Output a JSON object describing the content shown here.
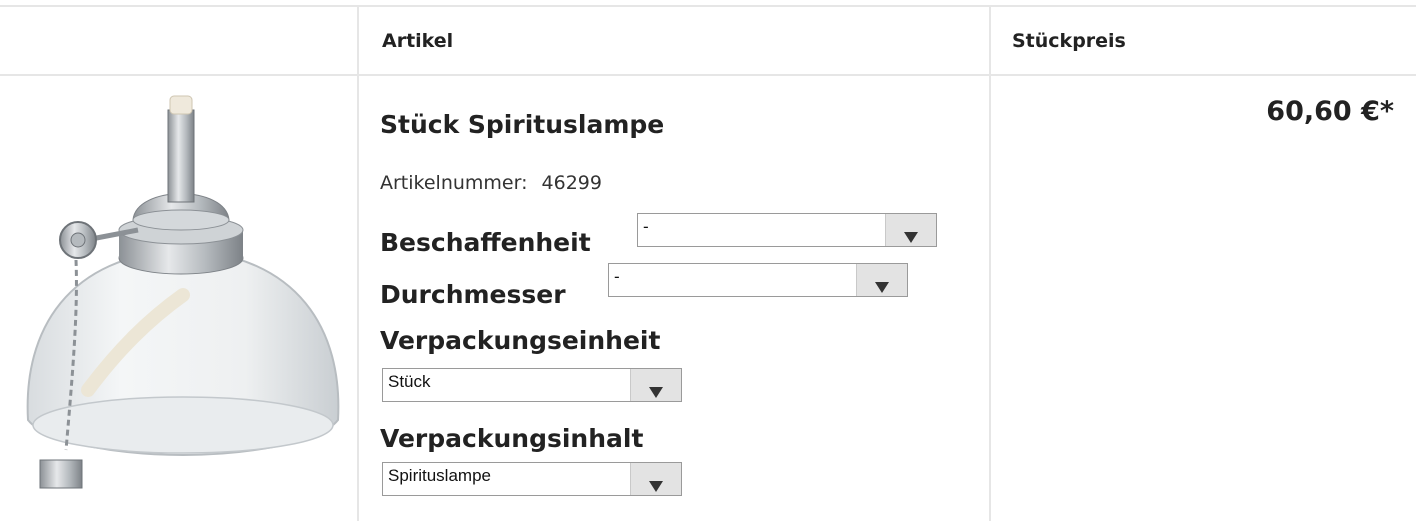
{
  "table": {
    "headers": {
      "col_article": "Artikel",
      "col_unit_price": "Stückpreis"
    }
  },
  "product": {
    "name": "Stück Spirituslampe",
    "article_number_label": "Artikelnummer:",
    "article_number": "46299",
    "price": "60,60 €*",
    "image": "alcohol-lamp-image",
    "options": {
      "beschaffenheit": {
        "label": "Beschaffenheit",
        "value": "-"
      },
      "durchmesser": {
        "label": "Durchmesser",
        "value": "-"
      },
      "verpackungseinheit": {
        "label": "Verpackungseinheit",
        "value": "Stück"
      },
      "verpackungsinhalt": {
        "label": "Verpackungsinhalt",
        "value": "Spirituslampe"
      }
    }
  },
  "colors": {
    "border": "#e6e6e6",
    "select_button": "#e3e3e3",
    "text": "#222222"
  }
}
